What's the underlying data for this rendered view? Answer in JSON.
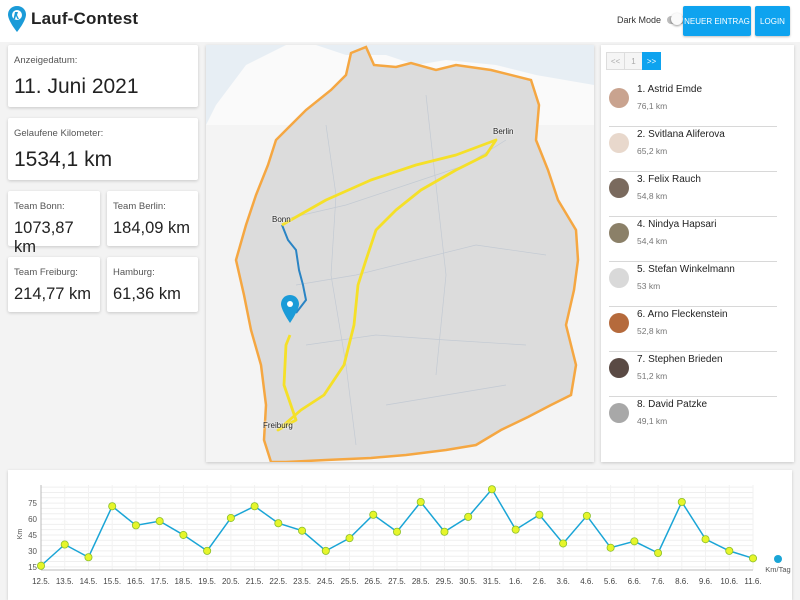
{
  "header": {
    "app_title": "Lauf-Contest",
    "dark_mode_label": "Dark Mode",
    "new_entry_label": "NEUER EINTRAG",
    "login_label": "LOGIN"
  },
  "stats": {
    "date_label": "Anzeigedatum:",
    "date_value": "11. Juni 2021",
    "km_label": "Gelaufene Kilometer:",
    "km_value": "1534,1 km",
    "teams": [
      {
        "label": "Team Bonn:",
        "value": "1073,87 km"
      },
      {
        "label": "Team Berlin:",
        "value": "184,09 km"
      },
      {
        "label": "Team Freiburg:",
        "value": "214,77 km"
      },
      {
        "label": "Hamburg:",
        "value": "61,36 km"
      }
    ]
  },
  "map": {
    "cities": {
      "berlin": "Berlin",
      "bonn": "Bonn",
      "freiburg": "Freiburg"
    },
    "route_color": "#f5e028",
    "border_color": "#f5a742",
    "marker_color": "#1b9bd8"
  },
  "leaderboard": {
    "pager": {
      "first": "<<",
      "page": "1",
      "next": ">>"
    },
    "runners": [
      {
        "name": "1. Astrid Emde",
        "km": "76,1 km",
        "avatar_color": "#c9a38f"
      },
      {
        "name": "2. Svitlana Aliferova",
        "km": "65,2 km",
        "avatar_color": "#e8d8cc"
      },
      {
        "name": "3. Felix Rauch",
        "km": "54,8 km",
        "avatar_color": "#7a6a5e"
      },
      {
        "name": "4. Nindya Hapsari",
        "km": "54,4 km",
        "avatar_color": "#8b8068"
      },
      {
        "name": "5. Stefan Winkelmann",
        "km": "53 km",
        "avatar_color": "#d9d9d9"
      },
      {
        "name": "6. Arno Fleckenstein",
        "km": "52,8 km",
        "avatar_color": "#b56a3c"
      },
      {
        "name": "7. Stephen Brieden",
        "km": "51,2 km",
        "avatar_color": "#5a4a44"
      },
      {
        "name": "8. David Patzke",
        "km": "49,1 km",
        "avatar_color": "#a8a8a8"
      }
    ]
  },
  "chart_data": {
    "type": "line",
    "x": [
      "12.5.",
      "13.5.",
      "14.5.",
      "15.5.",
      "16.5.",
      "17.5.",
      "18.5.",
      "19.5.",
      "20.5.",
      "21.5.",
      "22.5.",
      "23.5.",
      "24.5.",
      "25.5.",
      "26.5.",
      "27.5.",
      "28.5.",
      "29.5.",
      "30.5.",
      "31.5.",
      "1.6.",
      "2.6.",
      "3.6.",
      "4.6.",
      "5.6.",
      "6.6.",
      "7.6.",
      "8.6.",
      "9.6.",
      "10.6.",
      "11.6."
    ],
    "series": [
      {
        "name": "Km/Tag",
        "values": [
          16,
          36,
          24,
          72,
          54,
          58,
          45,
          30,
          61,
          72,
          56,
          49,
          30,
          42,
          64,
          48,
          76,
          48,
          62,
          88,
          50,
          64,
          37,
          63,
          33,
          39,
          28,
          76,
          41,
          30,
          23
        ]
      }
    ],
    "ylabel": "Km",
    "yticks": [
      15,
      30,
      45,
      60,
      75
    ],
    "ylim": [
      12,
      92
    ],
    "grid": true,
    "line_color": "#1aa5d6",
    "marker_color": "#e6f52a",
    "legend_position": "right"
  }
}
